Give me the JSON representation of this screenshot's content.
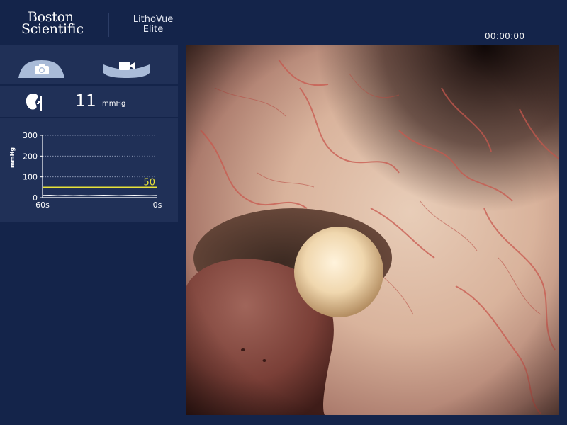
{
  "header": {
    "brand_line1": "Boston",
    "brand_line2": "Scientific",
    "product_line1": "LithoVue",
    "product_line2": "Elite",
    "timer": "00:00:00"
  },
  "capture": {
    "photo_icon": "camera-icon",
    "video_icon": "video-camera-icon"
  },
  "pressure": {
    "icon": "kidney-icon",
    "value": "11",
    "unit": "mmHg"
  },
  "pressure_chart": {
    "ylabel": "mmHg",
    "yticks": [
      "300",
      "200",
      "100",
      "0"
    ],
    "xticks": [
      "60s",
      "0s"
    ],
    "threshold_label": "50"
  },
  "chart_data": {
    "type": "line",
    "title": "",
    "xlabel": "",
    "ylabel": "mmHg",
    "xlim": [
      60,
      0
    ],
    "ylim": [
      0,
      300
    ],
    "xtick_labels": [
      "60s",
      "0s"
    ],
    "ytick_labels": [
      "300",
      "200",
      "100",
      "0"
    ],
    "grid": true,
    "threshold": {
      "value": 50,
      "label": "50",
      "color": "#e8e23a"
    },
    "series": [
      {
        "x": [
          60,
          56,
          52,
          48,
          44,
          40,
          36,
          32,
          28,
          24,
          20,
          16,
          12,
          8,
          4,
          0
        ],
        "values": [
          11,
          12,
          10,
          11,
          10,
          11,
          10,
          11,
          12,
          11,
          10,
          11,
          12,
          11,
          10,
          11
        ]
      }
    ]
  },
  "colors": {
    "background": "#14244a",
    "panel": "#203057",
    "threshold_line": "#e8e23a",
    "trace_line": "#ffffff",
    "button_fill": "#a9bbd8"
  }
}
